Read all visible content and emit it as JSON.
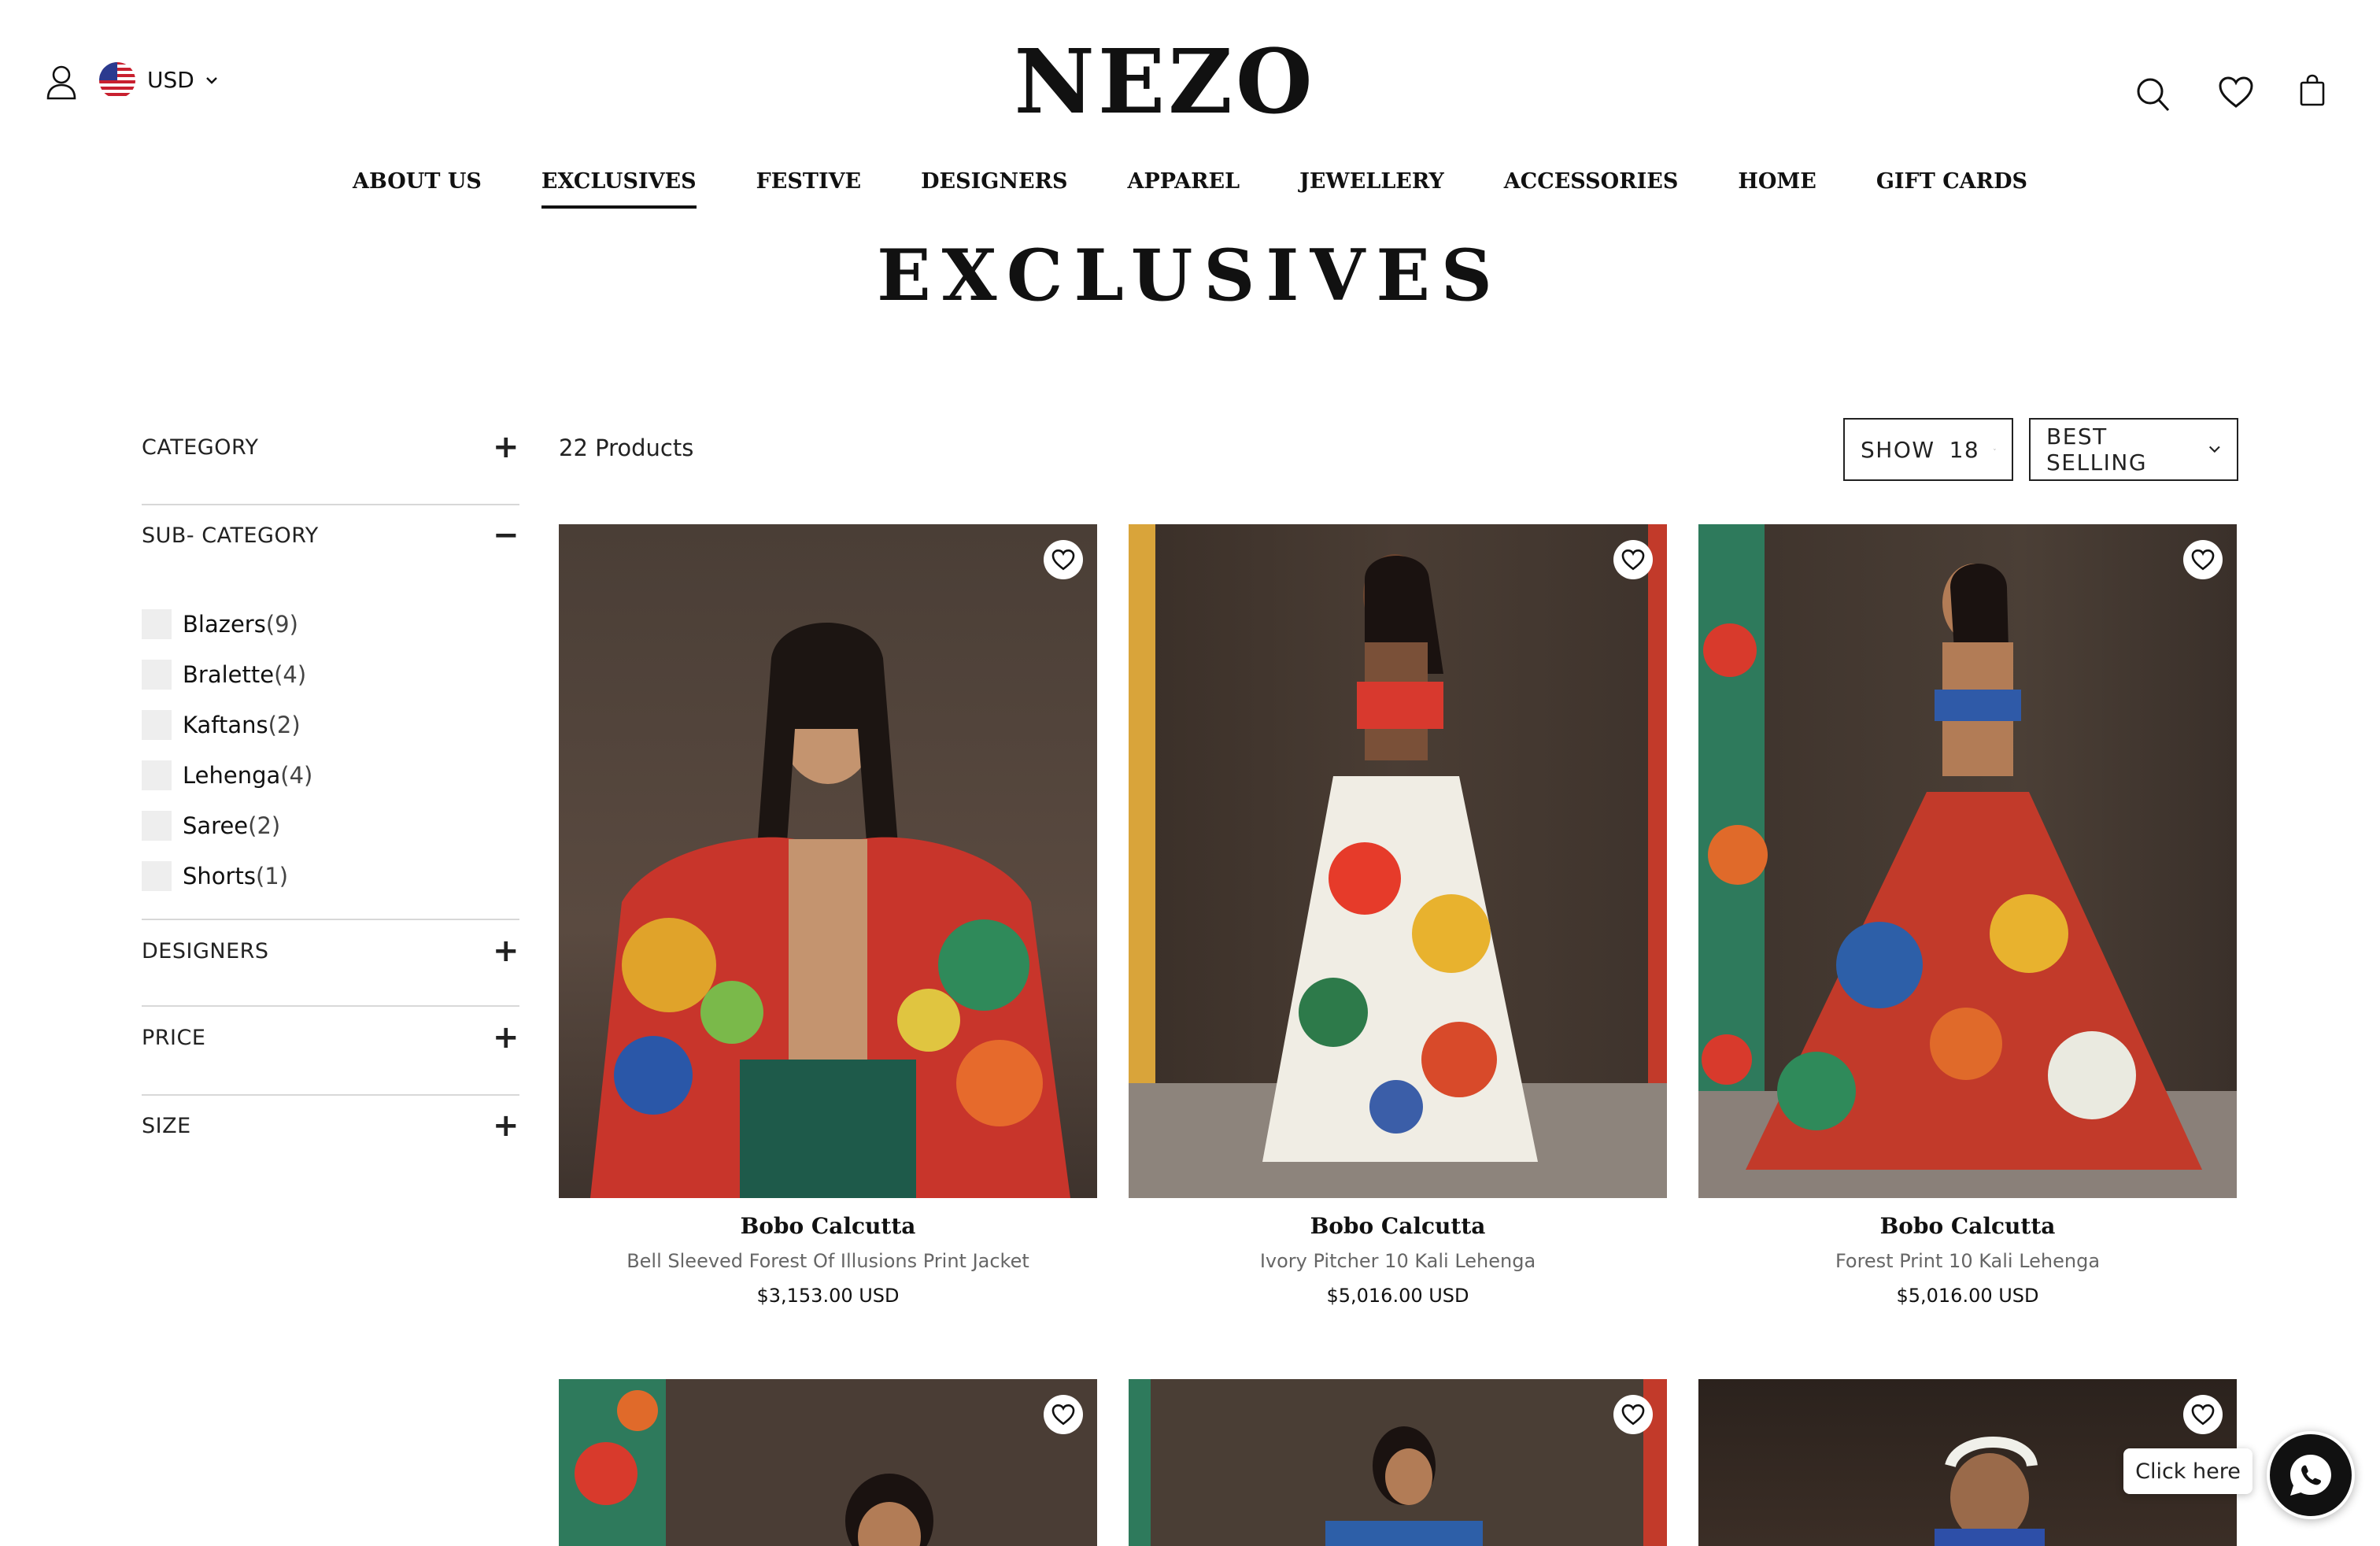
{
  "header": {
    "logo": "NEZO",
    "currency": "USD",
    "icons": [
      "user-icon",
      "us-flag-icon",
      "search-icon",
      "heart-icon",
      "bag-icon"
    ]
  },
  "nav": {
    "items": [
      {
        "label": "ABOUT US"
      },
      {
        "label": "EXCLUSIVES",
        "active": true
      },
      {
        "label": "FESTIVE"
      },
      {
        "label": "DESIGNERS"
      },
      {
        "label": "APPAREL"
      },
      {
        "label": "JEWELLERY"
      },
      {
        "label": "ACCESSORIES"
      },
      {
        "label": "HOME"
      },
      {
        "label": "GIFT CARDS"
      }
    ]
  },
  "page": {
    "title": "EXCLUSIVES"
  },
  "filters": {
    "category": "CATEGORY",
    "sub_category": "SUB- CATEGORY",
    "designers": "DESIGNERS",
    "price": "PRICE",
    "size": "SIZE",
    "plus": "+",
    "minus": "−",
    "sub_items": [
      {
        "name": "Blazers",
        "count": "(9)"
      },
      {
        "name": "Bralette",
        "count": "(4)"
      },
      {
        "name": "Kaftans",
        "count": "(2)"
      },
      {
        "name": "Lehenga",
        "count": "(4)"
      },
      {
        "name": "Saree",
        "count": "(2)"
      },
      {
        "name": "Shorts",
        "count": "(1)"
      }
    ]
  },
  "toolbar": {
    "count": "22 Products",
    "show_label": "SHOW",
    "show_value": "18",
    "sort_value": "BEST SELLING"
  },
  "products": [
    {
      "brand": "Bobo Calcutta",
      "name": "Bell Sleeved Forest Of Illusions Print Jacket",
      "price": "$3,153.00 USD"
    },
    {
      "brand": "Bobo Calcutta",
      "name": "Ivory Pitcher 10 Kali Lehenga",
      "price": "$5,016.00 USD"
    },
    {
      "brand": "Bobo Calcutta",
      "name": "Forest Print 10 Kali Lehenga",
      "price": "$5,016.00 USD"
    }
  ],
  "floating": {
    "click_here": "Click here"
  },
  "colors": {
    "text": "#111111",
    "divider": "#d8d8d8",
    "checkbox": "#eeeeee"
  }
}
